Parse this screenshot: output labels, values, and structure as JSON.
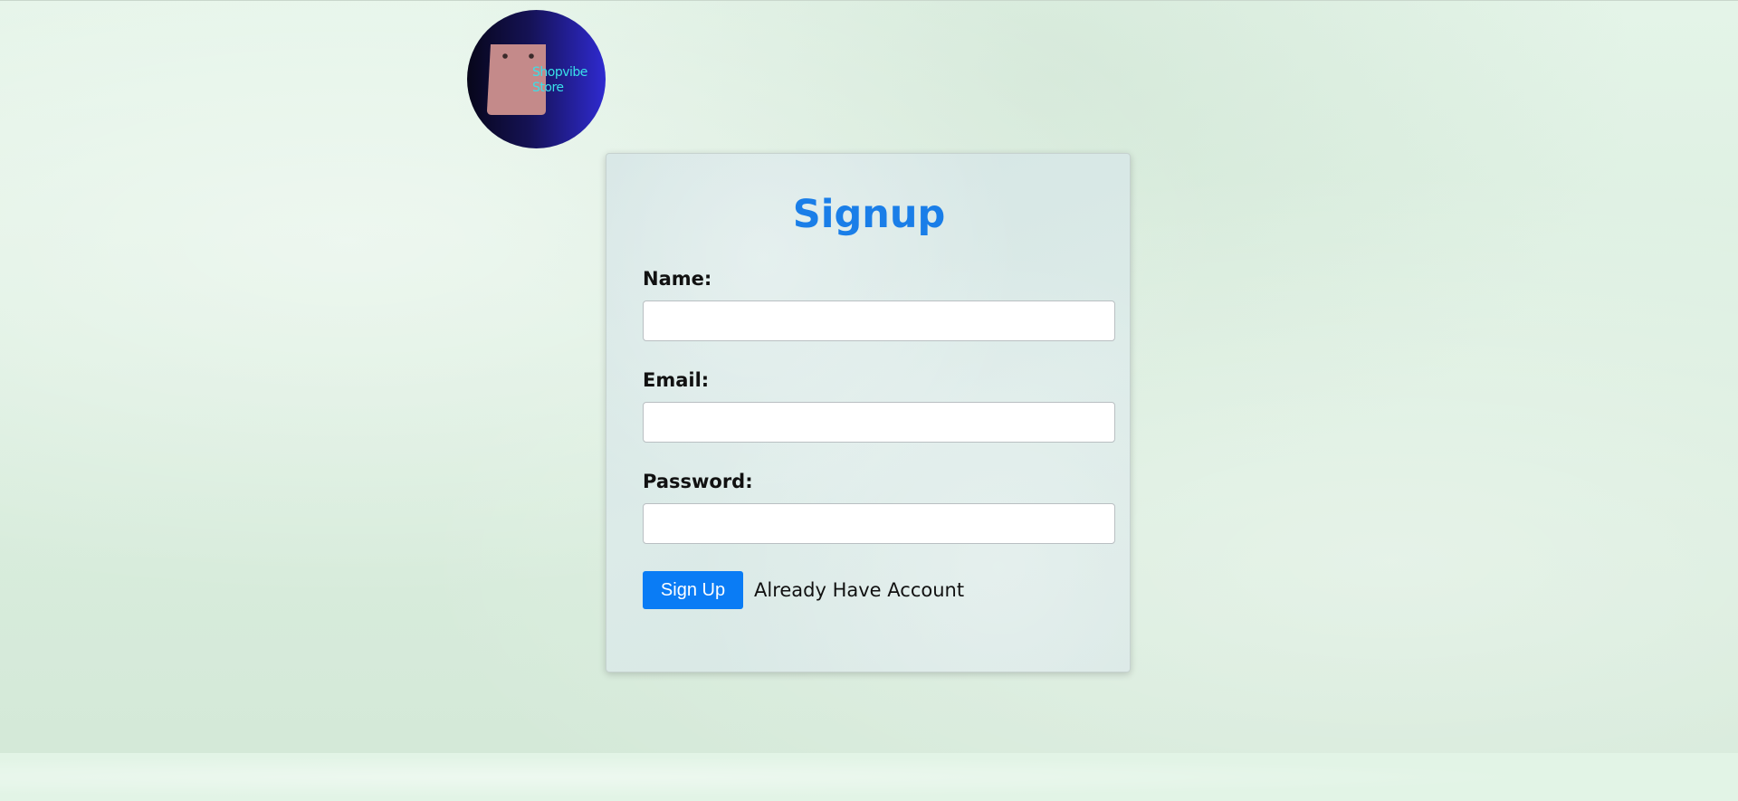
{
  "brand": {
    "line1": "Shopvibe",
    "line2": "Store"
  },
  "signup": {
    "title": "Signup",
    "name_label": "Name:",
    "name_value": "",
    "email_label": "Email:",
    "email_value": "",
    "password_label": "Password:",
    "password_value": "",
    "submit_label": "Sign Up",
    "login_link_label": "Already Have Account"
  },
  "colors": {
    "accent": "#0a7cf5",
    "title": "#1a7ee8",
    "logo_text": "#39e0e8",
    "bag": "#c48a8a"
  }
}
